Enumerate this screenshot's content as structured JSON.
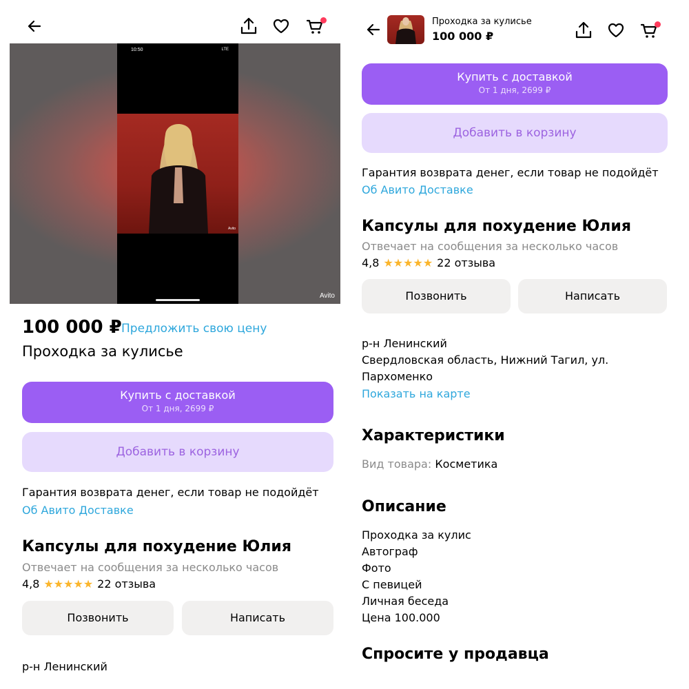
{
  "left": {
    "photo": {
      "status_time": "10:50",
      "status_right": "LTE",
      "watermark": "Avito",
      "watermark_small": "Avito"
    },
    "price": "100 000 ₽",
    "offer_link": "Предложить свою цену",
    "title": "Проходка за кулисье",
    "buy": {
      "label": "Купить с доставкой",
      "sub": "От 1 дня, 2699 ₽"
    },
    "add_to_cart": "Добавить в корзину",
    "guarantee": "Гарантия возврата денег, если товар не подойдёт",
    "delivery_link": "Об Авито Доставке",
    "seller": {
      "name": "Капсулы для похудение Юлия",
      "response": "Отвечает на сообщения за несколько часов",
      "rating": "4,8",
      "stars": "★★★★★",
      "reviews": "22 отзыва"
    },
    "call": "Позвонить",
    "message": "Написать",
    "district": "р-н Ленинский"
  },
  "right": {
    "header": {
      "title": "Проходка за кулисье",
      "price": "100 000 ₽"
    },
    "buy": {
      "label": "Купить с доставкой",
      "sub": "От 1 дня, 2699 ₽"
    },
    "add_to_cart": "Добавить в корзину",
    "guarantee": "Гарантия возврата денег, если товар не подойдёт",
    "delivery_link": "Об Авито Доставке",
    "seller": {
      "name": "Капсулы для похудение Юлия",
      "response": "Отвечает на сообщения за несколько часов",
      "rating": "4,8",
      "stars": "★★★★★",
      "reviews": "22 отзыва"
    },
    "call": "Позвонить",
    "message": "Написать",
    "address": {
      "district": "р-н Ленинский",
      "line1": "Свердловская область, Нижний Тагил, ул.",
      "line2": "Пархоменко",
      "map_link": "Показать на карте"
    },
    "characteristics": {
      "heading": "Характеристики",
      "label": "Вид товара:",
      "value": "Косметика"
    },
    "description": {
      "heading": "Описание",
      "lines": [
        "Проходка за кулис",
        "Автограф",
        "Фото",
        "С певицей",
        "Личная беседа",
        "Цена 100.000"
      ]
    },
    "ask_seller": "Спросите у продавца"
  },
  "colors": {
    "accent_purple": "#9b5ef3",
    "light_purple": "#e6dafd",
    "link_blue": "#2ea7dc",
    "star_yellow": "#fbb52b",
    "cart_dot": "#ff3b5c"
  },
  "icons": [
    "back-arrow-icon",
    "share-icon",
    "heart-icon",
    "cart-icon"
  ]
}
